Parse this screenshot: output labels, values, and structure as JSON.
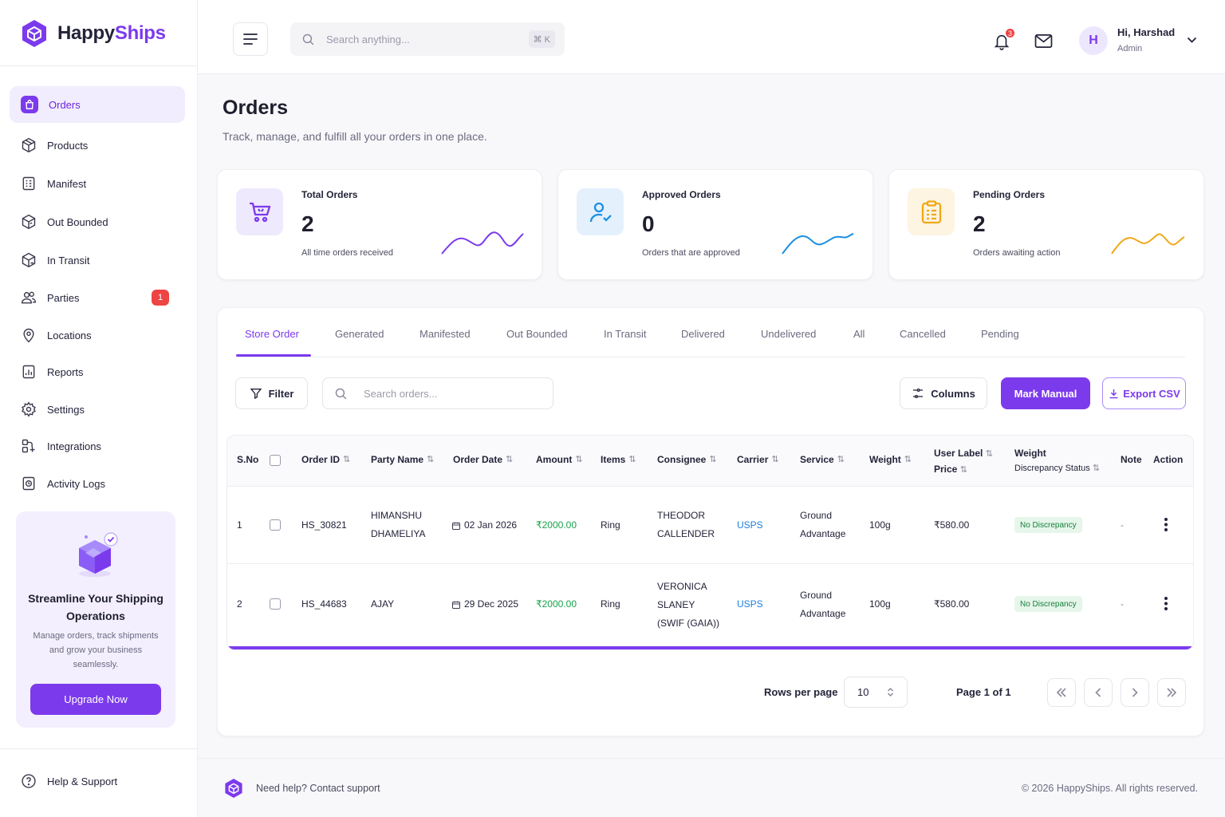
{
  "brand": {
    "name_part1": "Happy",
    "name_part2": "Ships",
    "accent": "#7c3aed"
  },
  "sidebar": {
    "items": [
      {
        "label": "Orders",
        "icon": "shopping-bag-icon",
        "active": true
      },
      {
        "label": "Products",
        "icon": "box-icon"
      },
      {
        "label": "Manifest",
        "icon": "clipboard-list-icon"
      },
      {
        "label": "Out Bounded",
        "icon": "package-out-icon"
      },
      {
        "label": "In Transit",
        "icon": "package-transit-icon"
      },
      {
        "label": "Parties",
        "icon": "users-icon",
        "badge": "1"
      },
      {
        "label": "Locations",
        "icon": "map-pin-icon"
      },
      {
        "label": "Reports",
        "icon": "report-icon"
      },
      {
        "label": "Settings",
        "icon": "gear-icon"
      },
      {
        "label": "Integrations",
        "icon": "integrations-icon"
      },
      {
        "label": "Activity Logs",
        "icon": "activity-log-icon"
      }
    ],
    "promo": {
      "title": "Streamline Your Shipping Operations",
      "text": "Manage orders, track shipments and grow your business seamlessly.",
      "button": "Upgrade Now"
    },
    "help": "Help & Support"
  },
  "header": {
    "search_placeholder": "Search anything...",
    "shortcut": "⌘ K",
    "notification_count": "3",
    "user_initial": "H",
    "greeting": "Hi, Harshad",
    "role": "Admin"
  },
  "page": {
    "title": "Orders",
    "subtitle": "Track, manage, and fulfill all your orders in one place."
  },
  "stats": [
    {
      "label": "Total Orders",
      "value": "2",
      "note": "All time orders received",
      "color": "#7c3aed"
    },
    {
      "label": "Approved Orders",
      "value": "0",
      "note": "Orders that are approved",
      "color": "#1d8fe0"
    },
    {
      "label": "Pending Orders",
      "value": "2",
      "note": "Orders awaiting action",
      "color": "#f0a818"
    }
  ],
  "tabs": [
    "Store Order",
    "Generated",
    "Manifested",
    "Out Bounded",
    "In Transit",
    "Delivered",
    "Undelivered",
    "All",
    "Cancelled",
    "Pending"
  ],
  "toolbar": {
    "filter": "Filter",
    "search_placeholder": "Search orders...",
    "columns": "Columns",
    "mark_manual": "Mark Manual",
    "export": "Export CSV"
  },
  "table": {
    "headers": {
      "sno": "S.No",
      "order_id": "Order ID",
      "party": "Party Name",
      "date": "Order Date",
      "amount": "Amount",
      "items": "Items",
      "consignee": "Consignee",
      "carrier": "Carrier",
      "service": "Service",
      "weight": "Weight",
      "label_price_1": "User Label",
      "label_price_2": "Price",
      "discrepancy_1": "Weight",
      "discrepancy_2": "Discrepancy Status",
      "note": "Note",
      "action": "Action"
    },
    "rows": [
      {
        "sno": "1",
        "order_id": "HS_30821",
        "party": [
          "HIMANSHU",
          "DHAMELIYA"
        ],
        "date": "02 Jan 2026",
        "amount": "₹2000.00",
        "items": "Ring",
        "consignee": [
          "THEODOR",
          "CALLENDER"
        ],
        "carrier": "USPS",
        "service": [
          "Ground",
          "Advantage"
        ],
        "weight": "100g",
        "label_price": "₹580.00",
        "discrepancy": "No Discrepancy",
        "note": "-"
      },
      {
        "sno": "2",
        "order_id": "HS_44683",
        "party": [
          "AJAY"
        ],
        "date": "29 Dec 2025",
        "amount": "₹2000.00",
        "items": "Ring",
        "consignee": [
          "VERONICA",
          "SLANEY",
          "(SWIF (GAIA))"
        ],
        "carrier": "USPS",
        "service": [
          "Ground",
          "Advantage"
        ],
        "weight": "100g",
        "label_price": "₹580.00",
        "discrepancy": "No Discrepancy",
        "note": "-"
      }
    ]
  },
  "pagination": {
    "rows_label": "Rows per page",
    "rows_value": "10",
    "page_text": "Page 1 of 1"
  },
  "footer": {
    "help": "Need help? Contact support",
    "copyright": "© 2026 HappyShips. All rights reserved."
  }
}
